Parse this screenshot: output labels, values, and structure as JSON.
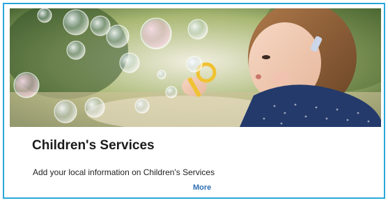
{
  "card": {
    "title": "Children's Services",
    "description": "Add your local information on Children's Services",
    "more_label": "More",
    "accent_color": "#2aa7d9",
    "link_color": "#2f6fb4",
    "image": {
      "subject": "girl-blowing-bubbles-photo"
    }
  }
}
